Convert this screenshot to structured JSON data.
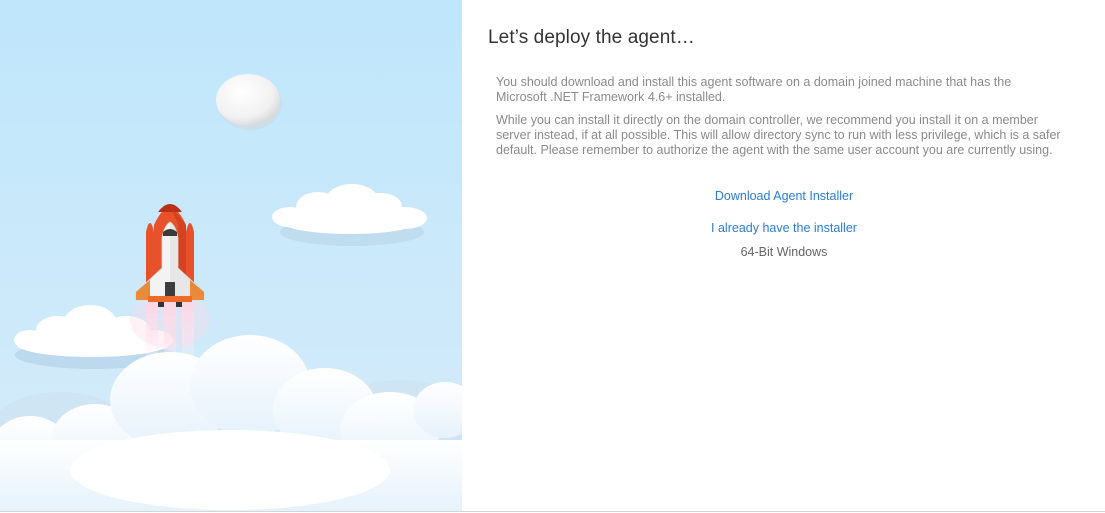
{
  "heading": "Let’s deploy the agent…",
  "paragraphs": [
    "You should download and install this agent software on a domain joined machine that has the Microsoft .NET Framework 4.6+ installed.",
    "While you can install it directly on the domain controller, we recommend you install it on a member server instead, if at all possible. This will allow directory sync to run with less privilege, which is a safer default. Please remember to authorize the agent with the same user account you are currently using."
  ],
  "links": {
    "download_installer": "Download Agent Installer",
    "already_have": "I already have the installer"
  },
  "os_label": "64-Bit Windows",
  "colors": {
    "sky_top": "#bfe6fb",
    "sky_bottom": "#d9eefb",
    "link": "#2a7dd6",
    "heading": "#333333",
    "body_text": "#8a8a8a",
    "rocket_body": "#e8522b",
    "rocket_nose": "#c8351a",
    "shuttle_white": "#f4f4f4"
  },
  "illustration": {
    "icons": [
      "moon-icon",
      "rocket-icon",
      "cloud-icon"
    ]
  }
}
